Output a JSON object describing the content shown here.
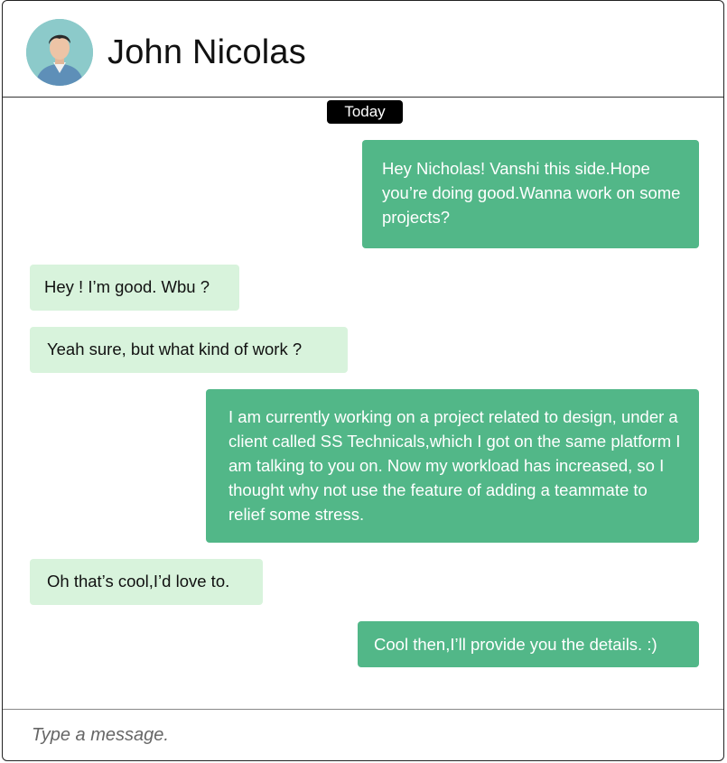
{
  "header": {
    "contact_name": "John Nicolas",
    "avatar_icon": "user-avatar-photo"
  },
  "chat": {
    "date_label": "Today",
    "messages": [
      {
        "direction": "sent",
        "text": "Hey Nicholas! Vanshi this side.Hope you’re doing good.Wanna work on some projects?"
      },
      {
        "direction": "received",
        "text": "Hey ! I’m good. Wbu ?"
      },
      {
        "direction": "received",
        "text": "Yeah sure, but what kind of work ?"
      },
      {
        "direction": "sent",
        "text": "I am currently working on a project related to design, under a client called SS Technicals,which I got on the same platform I am talking to you on. Now my workload has increased, so I thought why not use the feature of adding a teammate to relief some stress."
      },
      {
        "direction": "received",
        "text": "Oh that’s cool,I’d love to."
      },
      {
        "direction": "sent",
        "text": "Cool then,I’ll provide you the details. :)"
      }
    ]
  },
  "composer": {
    "value": "",
    "placeholder": "Type a message."
  },
  "colors": {
    "sent_bubble": "#52b788",
    "received_bubble": "#d8f3dc",
    "date_pill": "#000000"
  }
}
